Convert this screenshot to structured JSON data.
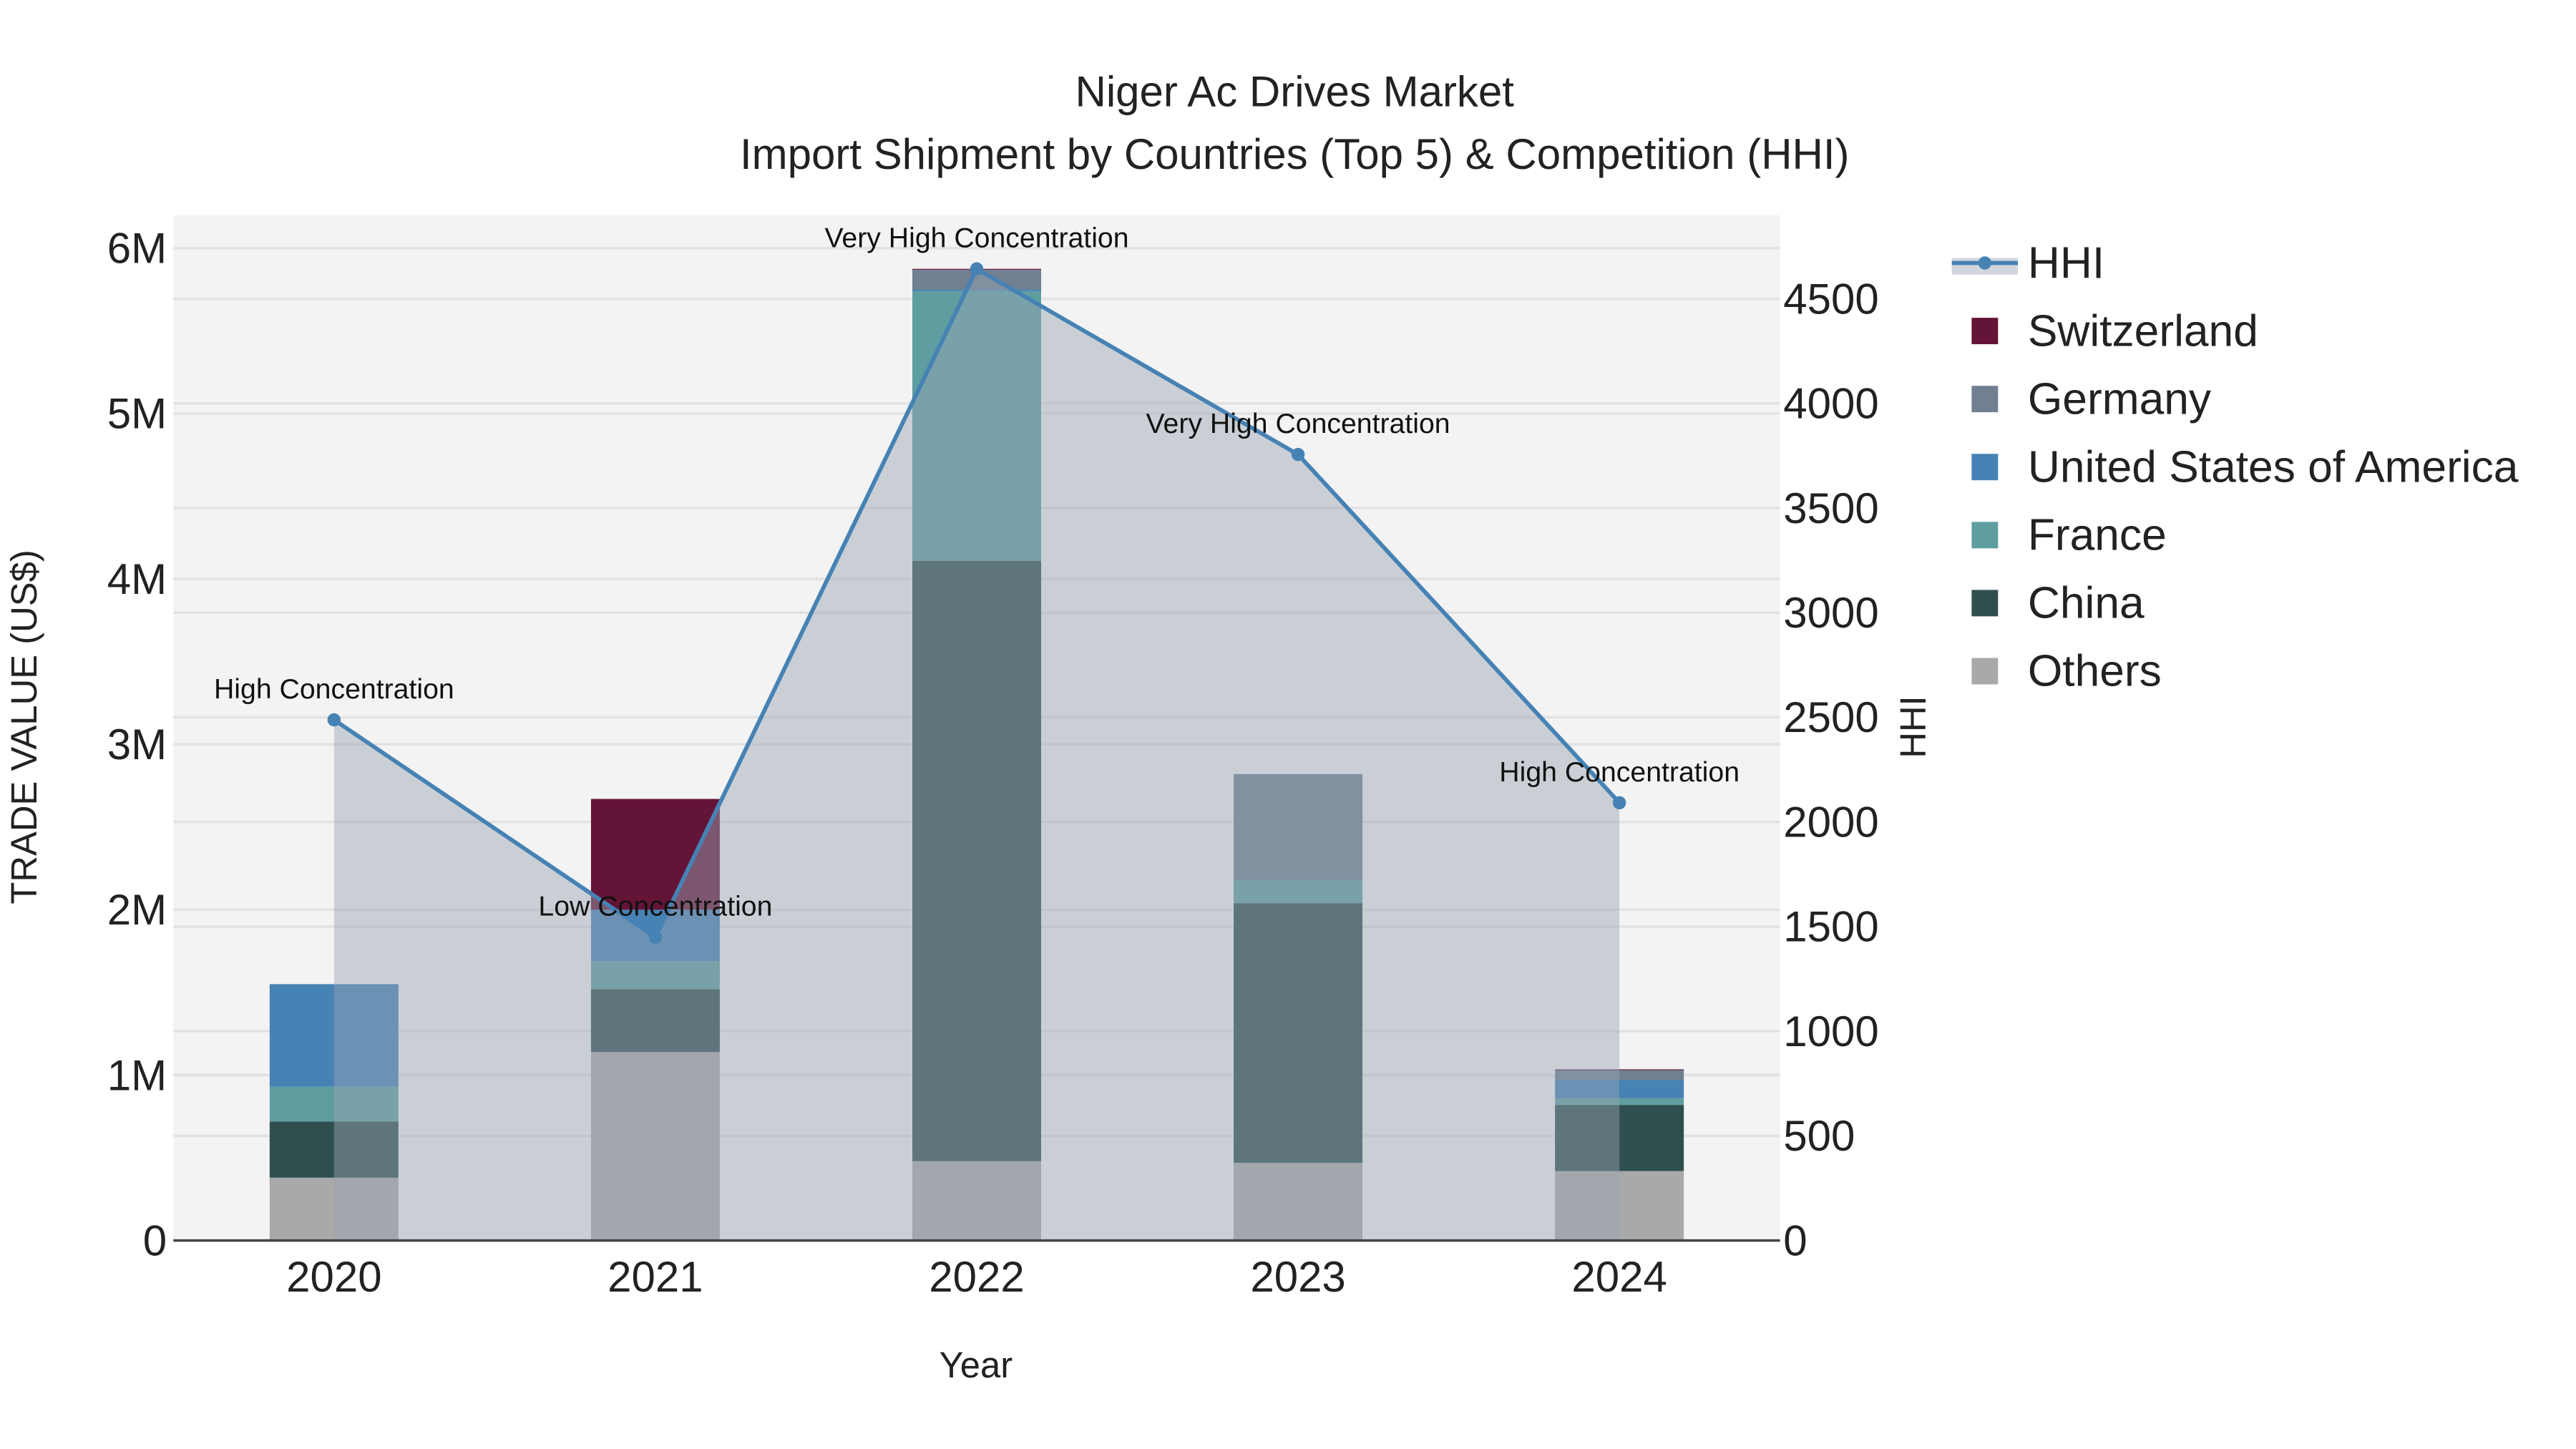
{
  "chart_data": {
    "type": "bar",
    "title": "Niger Ac Drives Market",
    "subtitle": "Import Shipment by Countries (Top 5) & Competition (HHI)",
    "xlabel": "Year",
    "ylabel": "TRADE VALUE (US$)",
    "y2label": "HHI",
    "categories": [
      "2020",
      "2021",
      "2022",
      "2023",
      "2024"
    ],
    "ylim": [
      0,
      6200000
    ],
    "y2lim": [
      0,
      4900
    ],
    "yticks": [
      {
        "v": 0,
        "label": "0"
      },
      {
        "v": 1000000,
        "label": "1M"
      },
      {
        "v": 2000000,
        "label": "2M"
      },
      {
        "v": 3000000,
        "label": "3M"
      },
      {
        "v": 4000000,
        "label": "4M"
      },
      {
        "v": 5000000,
        "label": "5M"
      },
      {
        "v": 6000000,
        "label": "6M"
      }
    ],
    "y2ticks": [
      0,
      500,
      1000,
      1500,
      2000,
      2500,
      3000,
      3500,
      4000,
      4500
    ],
    "series": [
      {
        "name": "Others",
        "color": "#a9a9a9",
        "values": [
          380000,
          1140000,
          480000,
          470000,
          420000
        ]
      },
      {
        "name": "China",
        "color": "#2f4f4f",
        "values": [
          340000,
          380000,
          3630000,
          1570000,
          400000
        ]
      },
      {
        "name": "France",
        "color": "#5f9ea0",
        "values": [
          210000,
          170000,
          1630000,
          140000,
          40000
        ]
      },
      {
        "name": "United States of America",
        "color": "#4682b4",
        "values": [
          620000,
          310000,
          10000,
          0,
          110000
        ]
      },
      {
        "name": "Germany",
        "color": "#708090",
        "values": [
          0,
          0,
          120000,
          640000,
          60000
        ]
      },
      {
        "name": "Switzerland",
        "color": "#641436",
        "values": [
          0,
          670000,
          5000,
          0,
          5000
        ]
      }
    ],
    "hhi": {
      "name": "HHI",
      "color": "#4682b4",
      "values": [
        2488,
        1450,
        4643,
        3756,
        2092
      ],
      "annotations": [
        "High Concentration",
        "Low Concentration",
        "Very High Concentration",
        "Very High Concentration",
        "High Concentration"
      ]
    },
    "legend_order": [
      "HHI",
      "Switzerland",
      "Germany",
      "United States of America",
      "France",
      "China",
      "Others"
    ],
    "legend": "right",
    "grid": true
  }
}
